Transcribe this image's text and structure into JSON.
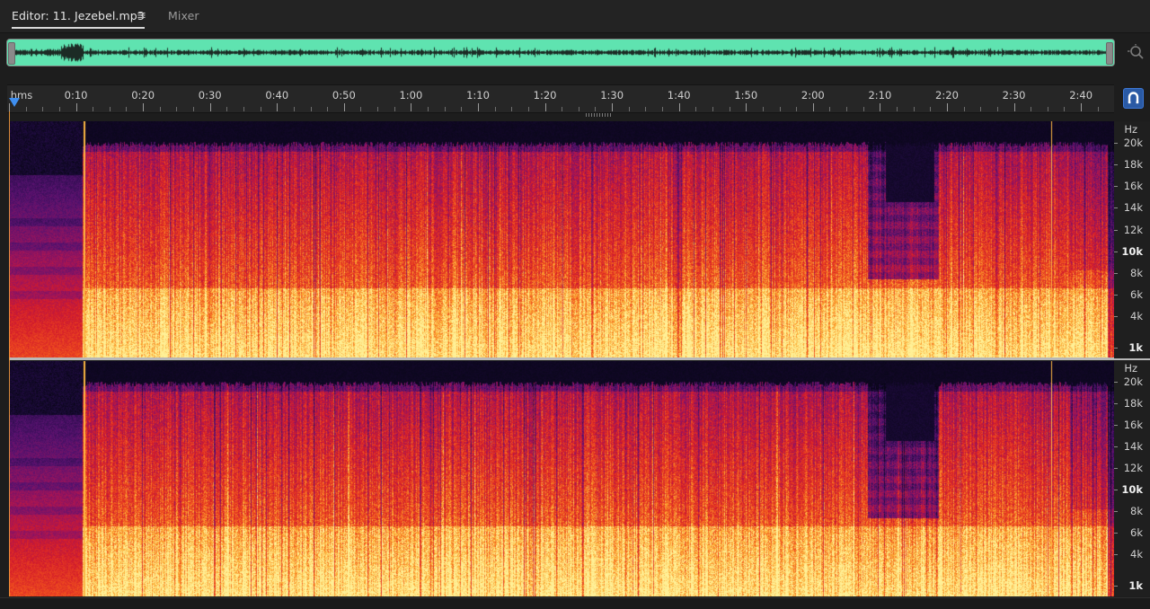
{
  "tabs": {
    "editor_label": "Editor: 11. Jezebel.mp3",
    "menu_icon": "≡",
    "mixer_label": "Mixer"
  },
  "overview": {
    "color": "#5fe3b0"
  },
  "ruler": {
    "unit_label": "hms",
    "ticks": [
      {
        "label": "0:10",
        "sec": 10
      },
      {
        "label": "0:20",
        "sec": 20
      },
      {
        "label": "0:30",
        "sec": 30
      },
      {
        "label": "0:40",
        "sec": 40
      },
      {
        "label": "0:50",
        "sec": 50
      },
      {
        "label": "1:00",
        "sec": 60
      },
      {
        "label": "1:10",
        "sec": 70
      },
      {
        "label": "1:20",
        "sec": 80
      },
      {
        "label": "1:30",
        "sec": 90
      },
      {
        "label": "1:40",
        "sec": 100
      },
      {
        "label": "1:50",
        "sec": 110
      },
      {
        "label": "2:00",
        "sec": 120
      },
      {
        "label": "2:10",
        "sec": 130
      },
      {
        "label": "2:20",
        "sec": 140
      },
      {
        "label": "2:30",
        "sec": 150
      },
      {
        "label": "2:40",
        "sec": 160
      }
    ]
  },
  "spectral": {
    "channels": 2,
    "unit": "Hz",
    "freq_labels": [
      {
        "label": "20k",
        "khz": 20,
        "bold": false
      },
      {
        "label": "18k",
        "khz": 18,
        "bold": false
      },
      {
        "label": "16k",
        "khz": 16,
        "bold": false
      },
      {
        "label": "14k",
        "khz": 14,
        "bold": false
      },
      {
        "label": "12k",
        "khz": 12,
        "bold": false
      },
      {
        "label": "10k",
        "khz": 10,
        "bold": true
      },
      {
        "label": "8k",
        "khz": 8,
        "bold": false
      },
      {
        "label": "6k",
        "khz": 6,
        "bold": false
      },
      {
        "label": "4k",
        "khz": 4,
        "bold": false
      },
      {
        "label": "1k",
        "khz": 1,
        "bold": true
      }
    ]
  }
}
